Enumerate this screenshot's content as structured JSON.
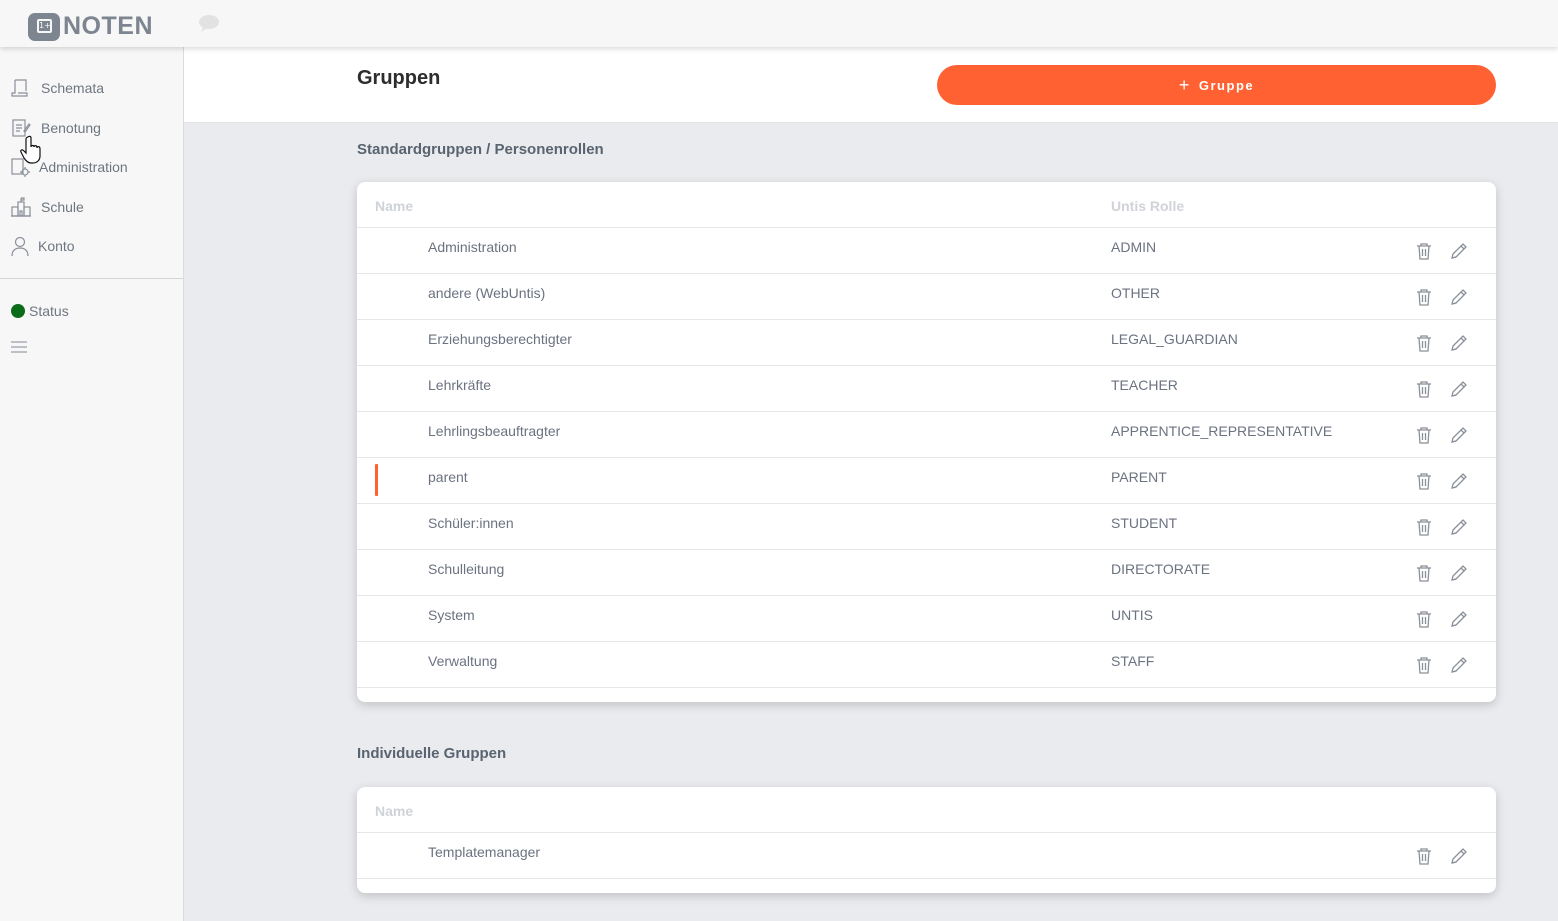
{
  "app": {
    "logo_text": "NOTEN",
    "logo_badge": "1+"
  },
  "sidebar": {
    "items": [
      {
        "label": "Schemata",
        "icon": "schema-icon"
      },
      {
        "label": "Benotung",
        "icon": "grading-icon"
      },
      {
        "label": "Administration",
        "icon": "admin-gear-icon"
      },
      {
        "label": "Schule",
        "icon": "school-building-icon"
      },
      {
        "label": "Konto",
        "icon": "user-icon"
      }
    ],
    "status_label": "Status",
    "status_color": "#0a6b1b"
  },
  "header": {
    "title": "Gruppen",
    "add_button_label": "Gruppe",
    "add_button_icon": "plus-icon",
    "accent_color": "#ff6133"
  },
  "standard_groups": {
    "title": "Standardgruppen / Personenrollen",
    "columns": {
      "name": "Name",
      "role": "Untis Rolle"
    },
    "rows": [
      {
        "name": "Administration",
        "role": "ADMIN"
      },
      {
        "name": "andere (WebUntis)",
        "role": "OTHER"
      },
      {
        "name": "Erziehungsberechtigter",
        "role": "LEGAL_GUARDIAN"
      },
      {
        "name": "Lehrkräfte",
        "role": "TEACHER"
      },
      {
        "name": "Lehrlingsbeauftragter",
        "role": "APPRENTICE_REPRESENTATIVE"
      },
      {
        "name": "parent",
        "role": "PARENT"
      },
      {
        "name": "Schüler:innen",
        "role": "STUDENT"
      },
      {
        "name": "Schulleitung",
        "role": "DIRECTORATE"
      },
      {
        "name": "System",
        "role": "UNTIS"
      },
      {
        "name": "Verwaltung",
        "role": "STAFF"
      }
    ]
  },
  "individual_groups": {
    "title": "Individuelle Gruppen",
    "columns": {
      "name": "Name"
    },
    "rows": [
      {
        "name": "Templatemanager"
      }
    ]
  }
}
